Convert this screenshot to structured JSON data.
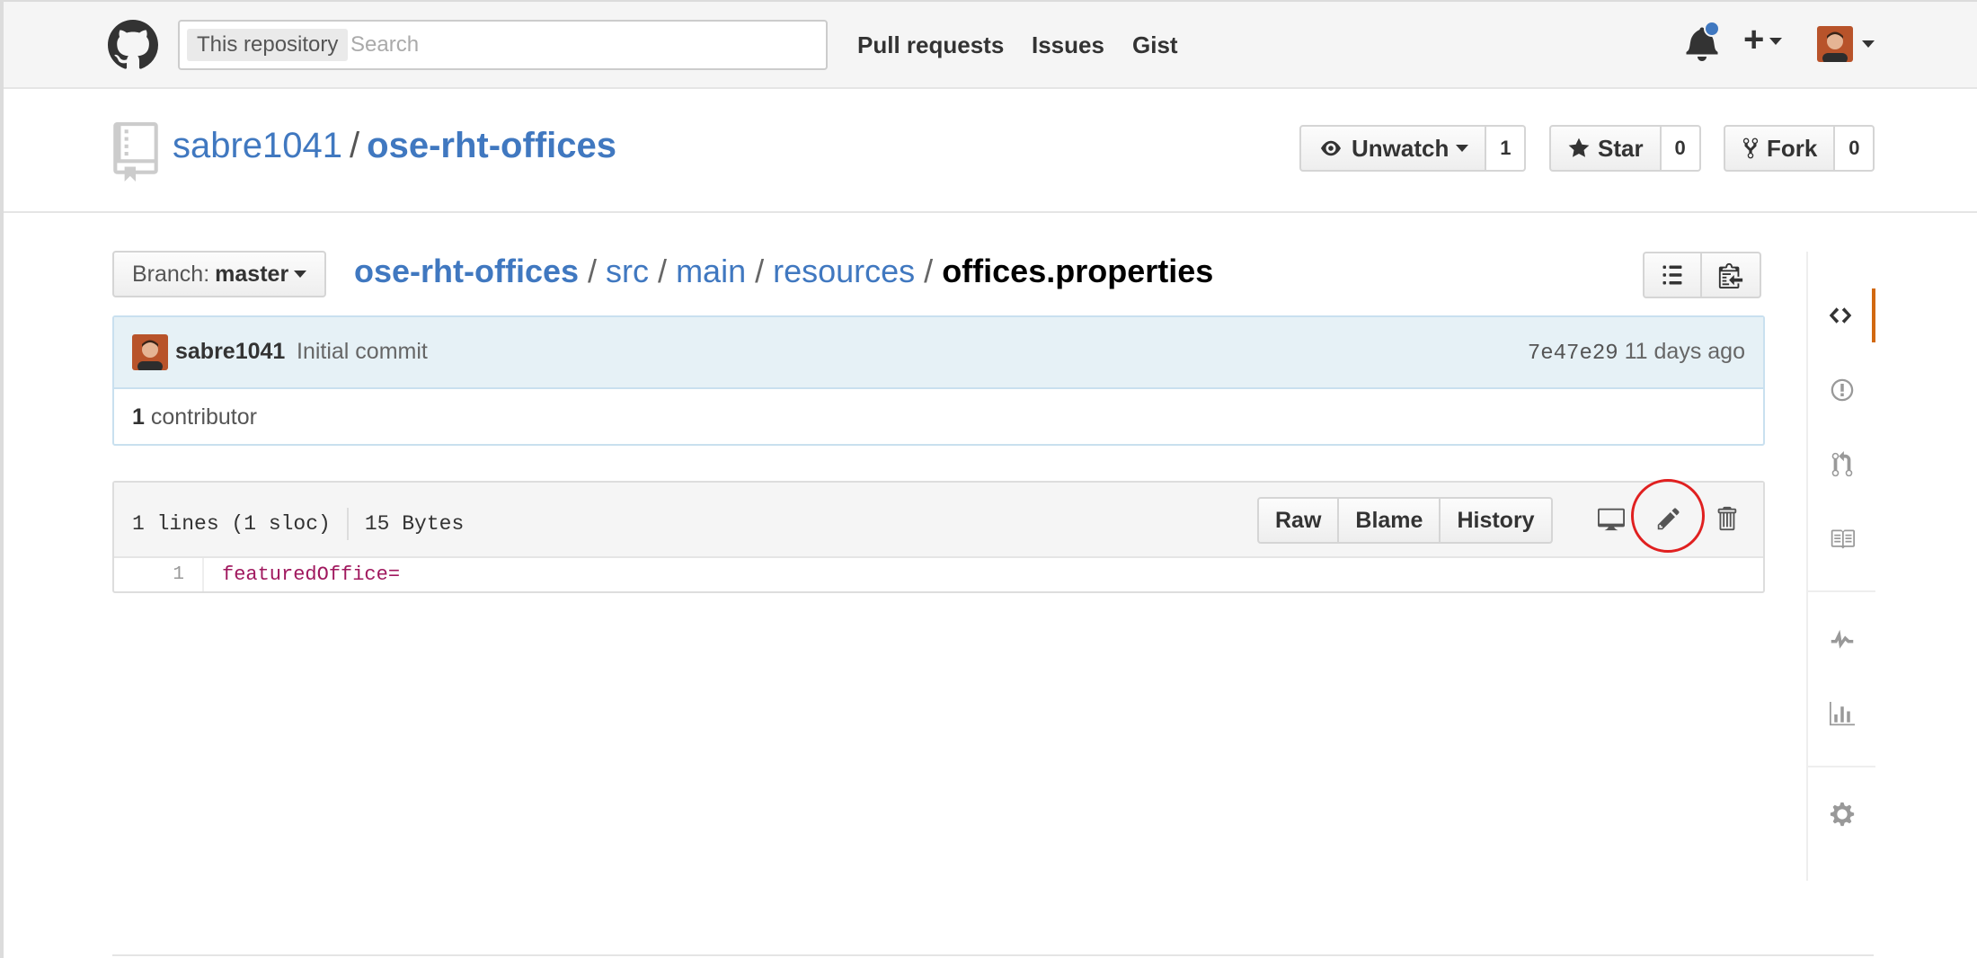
{
  "header": {
    "search_scope": "This repository",
    "search_placeholder": "Search",
    "nav": [
      "Pull requests",
      "Issues",
      "Gist"
    ]
  },
  "repo": {
    "owner": "sabre1041",
    "separator": "/",
    "name": "ose-rht-offices",
    "actions": {
      "watch_label": "Unwatch",
      "watch_count": "1",
      "star_label": "Star",
      "star_count": "0",
      "fork_label": "Fork",
      "fork_count": "0"
    }
  },
  "file_nav": {
    "branch_prefix": "Branch:",
    "branch_name": "master",
    "breadcrumb": [
      "ose-rht-offices",
      "src",
      "main",
      "resources"
    ],
    "file_name": "offices.properties"
  },
  "commit": {
    "author": "sabre1041",
    "message": "Initial commit",
    "sha": "7e47e29",
    "time": "11 days ago",
    "contributor_count": "1",
    "contributor_label": "contributor"
  },
  "file": {
    "lines_info": "1 lines (1 sloc)",
    "size": "15 Bytes",
    "buttons": [
      "Raw",
      "Blame",
      "History"
    ],
    "code_lines": [
      {
        "num": "1",
        "text": "featuredOffice="
      }
    ]
  },
  "colors": {
    "link": "#4078c0",
    "active_tab": "#d26911",
    "highlight": "#e02020",
    "notification": "#4078c0"
  }
}
